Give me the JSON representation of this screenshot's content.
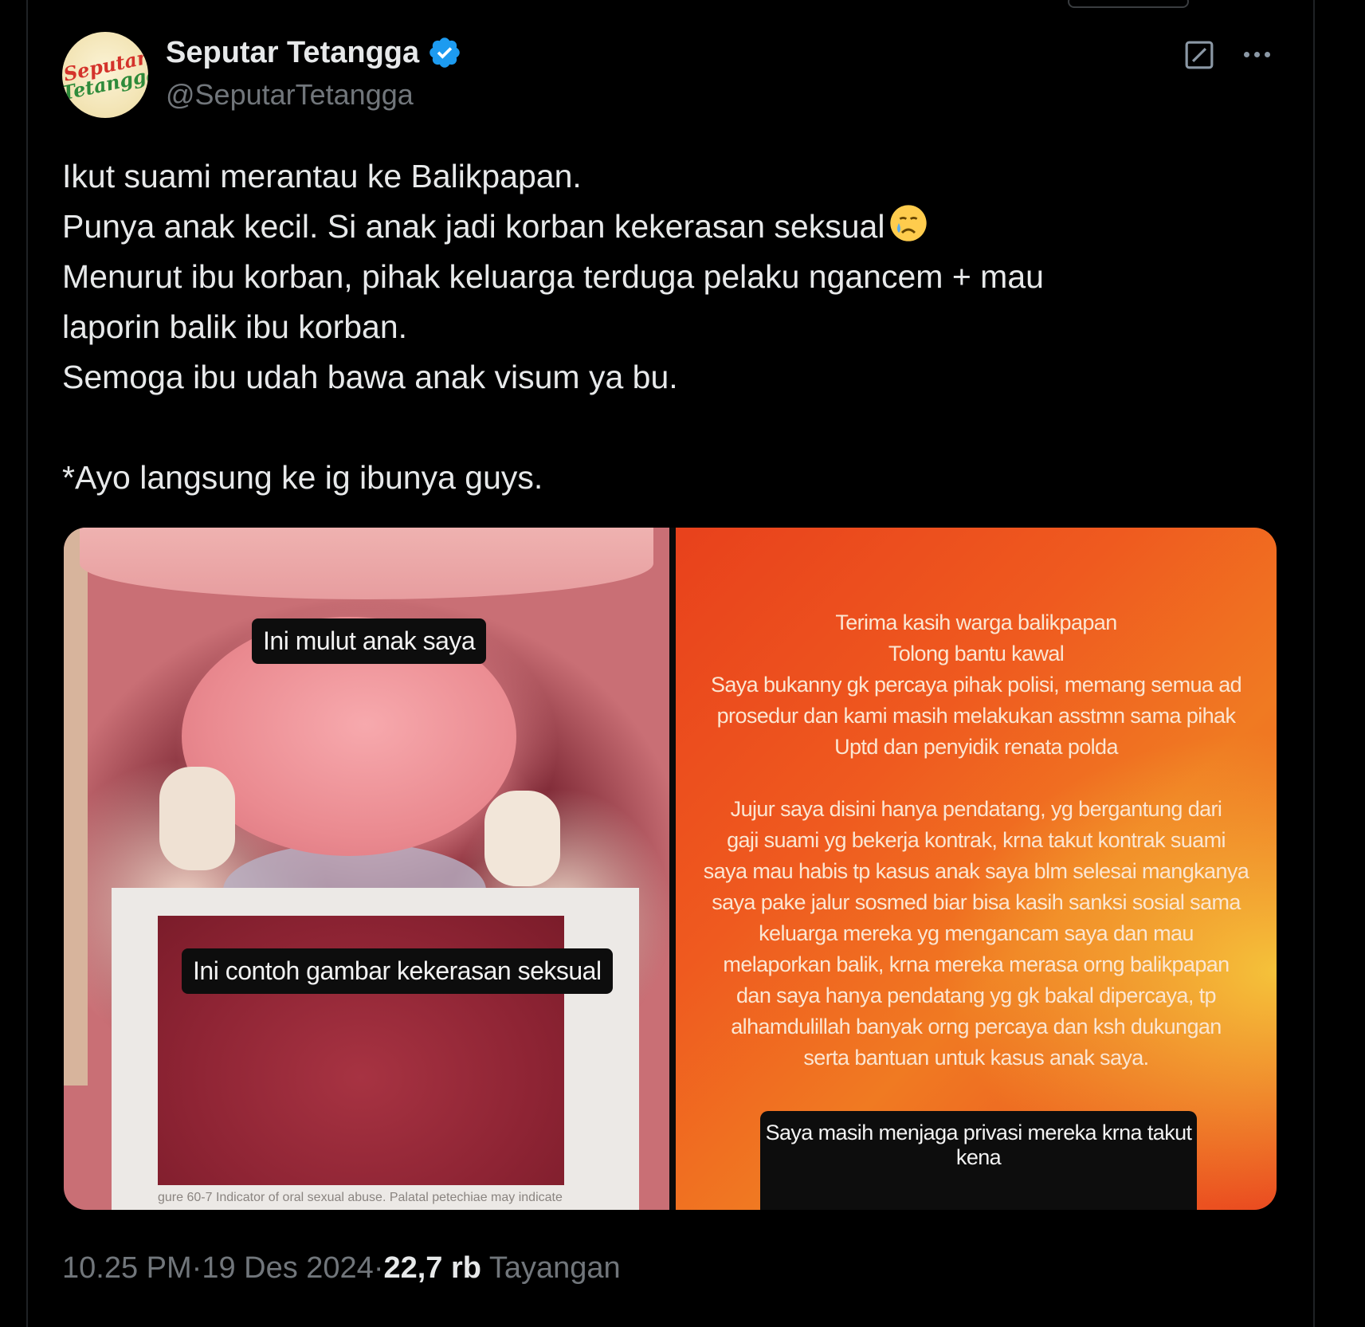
{
  "author": {
    "display_name": "Seputar Tetangga",
    "handle": "@SeputarTetangga",
    "avatar_text_1": "Seputar",
    "avatar_text_2": "Tetangga",
    "verified_icon": "verified-badge-icon",
    "verified_color": "#1d9bf0"
  },
  "header_icons": {
    "grok": "grok-icon",
    "more": "more-icon"
  },
  "tweet": {
    "lines": [
      "Ikut suami merantau ke Balikpapan.",
      "Punya anak kecil. Si anak jadi korban kekerasan seksual",
      "Menurut ibu korban, pihak keluarga terduga pelaku ngancem + mau",
      "laporin balik ibu korban.",
      "Semoga ibu udah bawa anak visum ya bu.",
      "*Ayo langsung ke ig ibunya guys."
    ],
    "emoji": "crying-face-emoji"
  },
  "media": {
    "left": {
      "label_1": "Ini mulut anak saya",
      "label_2": "Ini contoh gambar kekerasan seksual",
      "caption": "gure 60-7   Indicator of oral sexual abuse. Palatal petechiae may indicate"
    },
    "right": {
      "paragraph_1": [
        "Terima kasih warga balikpapan",
        "Tolong bantu kawal",
        "Saya bukanny gk percaya pihak polisi, memang semua ad",
        "prosedur dan kami masih melakukan asstmn sama pihak",
        "Uptd dan penyidik renata polda"
      ],
      "paragraph_2": [
        "Jujur saya disini hanya pendatang, yg bergantung dari",
        "gaji suami yg bekerja kontrak, krna takut kontrak suami",
        "saya mau habis tp kasus anak saya blm selesai mangkanya",
        "saya pake jalur sosmed  biar bisa kasih sanksi sosial sama",
        "keluarga mereka yg mengancam saya dan mau",
        "melaporkan balik, krna mereka merasa orng balikpapan",
        "dan saya hanya pendatang yg gk bakal dipercaya, tp",
        "alhamdulillah banyak orng percaya dan ksh dukungan",
        "serta bantuan untuk kasus anak saya."
      ],
      "bottom_box": "Saya masih menjaga privasi mereka krna takut kena"
    }
  },
  "meta": {
    "time": "10.25 PM",
    "separator": " · ",
    "date": "19 Des 2024",
    "views_count": "22,7 rb",
    "views_label": " Tayangan"
  }
}
